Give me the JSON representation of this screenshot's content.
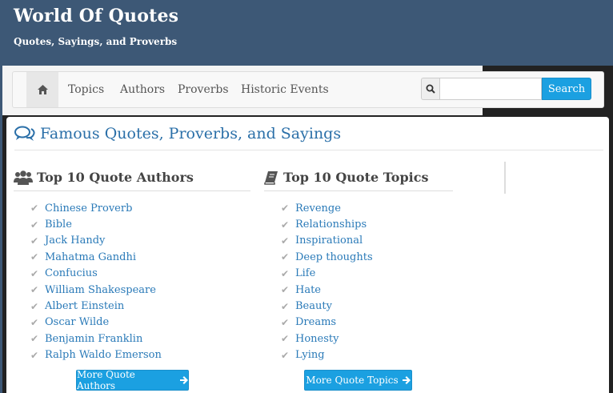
{
  "site": {
    "title": "World Of Quotes",
    "tagline": "Quotes, Sayings, and Proverbs"
  },
  "nav": {
    "home_icon": "home-icon",
    "items": [
      {
        "label": "Topics"
      },
      {
        "label": "Authors"
      },
      {
        "label": "Proverbs"
      },
      {
        "label": "Historic Events"
      }
    ],
    "search": {
      "icon": "search-icon",
      "value": "",
      "placeholder": "",
      "button_label": "Search"
    }
  },
  "main": {
    "title": "Famous Quotes, Proverbs, and Sayings",
    "title_icon": "speech-bubbles-icon"
  },
  "authors": {
    "title": "Top 10 Quote Authors",
    "icon": "users-icon",
    "items": [
      "Chinese Proverb",
      "Bible",
      "Jack Handy",
      "Mahatma Gandhi",
      "Confucius",
      "William Shakespeare",
      "Albert Einstein",
      "Oscar Wilde",
      "Benjamin Franklin",
      "Ralph Waldo Emerson"
    ],
    "more_label": "More Quote Authors"
  },
  "topics": {
    "title": "Top 10 Quote Topics",
    "icon": "book-icon",
    "items": [
      "Revenge",
      "Relationships",
      "Inspirational",
      "Deep thoughts",
      "Life",
      "Hate",
      "Beauty",
      "Dreams",
      "Honesty",
      "Lying"
    ],
    "more_label": "More Quote Topics"
  },
  "colors": {
    "header_bg": "#3d5876",
    "link": "#2a7ab8",
    "button": "#1ba0e1"
  }
}
